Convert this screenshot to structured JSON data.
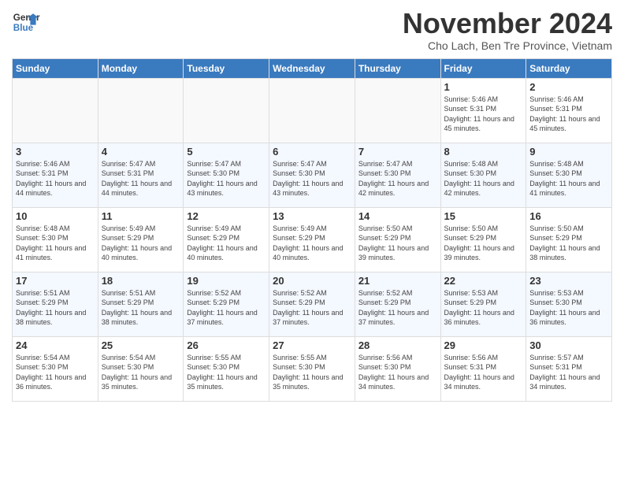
{
  "header": {
    "logo_line1": "General",
    "logo_line2": "Blue",
    "month": "November 2024",
    "location": "Cho Lach, Ben Tre Province, Vietnam"
  },
  "days_of_week": [
    "Sunday",
    "Monday",
    "Tuesday",
    "Wednesday",
    "Thursday",
    "Friday",
    "Saturday"
  ],
  "weeks": [
    [
      {
        "day": "",
        "empty": true
      },
      {
        "day": "",
        "empty": true
      },
      {
        "day": "",
        "empty": true
      },
      {
        "day": "",
        "empty": true
      },
      {
        "day": "",
        "empty": true
      },
      {
        "day": "1",
        "sunrise": "5:46 AM",
        "sunset": "5:31 PM",
        "daylight": "11 hours and 45 minutes."
      },
      {
        "day": "2",
        "sunrise": "5:46 AM",
        "sunset": "5:31 PM",
        "daylight": "11 hours and 45 minutes."
      }
    ],
    [
      {
        "day": "3",
        "sunrise": "5:46 AM",
        "sunset": "5:31 PM",
        "daylight": "11 hours and 44 minutes."
      },
      {
        "day": "4",
        "sunrise": "5:47 AM",
        "sunset": "5:31 PM",
        "daylight": "11 hours and 44 minutes."
      },
      {
        "day": "5",
        "sunrise": "5:47 AM",
        "sunset": "5:30 PM",
        "daylight": "11 hours and 43 minutes."
      },
      {
        "day": "6",
        "sunrise": "5:47 AM",
        "sunset": "5:30 PM",
        "daylight": "11 hours and 43 minutes."
      },
      {
        "day": "7",
        "sunrise": "5:47 AM",
        "sunset": "5:30 PM",
        "daylight": "11 hours and 42 minutes."
      },
      {
        "day": "8",
        "sunrise": "5:48 AM",
        "sunset": "5:30 PM",
        "daylight": "11 hours and 42 minutes."
      },
      {
        "day": "9",
        "sunrise": "5:48 AM",
        "sunset": "5:30 PM",
        "daylight": "11 hours and 41 minutes."
      }
    ],
    [
      {
        "day": "10",
        "sunrise": "5:48 AM",
        "sunset": "5:30 PM",
        "daylight": "11 hours and 41 minutes."
      },
      {
        "day": "11",
        "sunrise": "5:49 AM",
        "sunset": "5:29 PM",
        "daylight": "11 hours and 40 minutes."
      },
      {
        "day": "12",
        "sunrise": "5:49 AM",
        "sunset": "5:29 PM",
        "daylight": "11 hours and 40 minutes."
      },
      {
        "day": "13",
        "sunrise": "5:49 AM",
        "sunset": "5:29 PM",
        "daylight": "11 hours and 40 minutes."
      },
      {
        "day": "14",
        "sunrise": "5:50 AM",
        "sunset": "5:29 PM",
        "daylight": "11 hours and 39 minutes."
      },
      {
        "day": "15",
        "sunrise": "5:50 AM",
        "sunset": "5:29 PM",
        "daylight": "11 hours and 39 minutes."
      },
      {
        "day": "16",
        "sunrise": "5:50 AM",
        "sunset": "5:29 PM",
        "daylight": "11 hours and 38 minutes."
      }
    ],
    [
      {
        "day": "17",
        "sunrise": "5:51 AM",
        "sunset": "5:29 PM",
        "daylight": "11 hours and 38 minutes."
      },
      {
        "day": "18",
        "sunrise": "5:51 AM",
        "sunset": "5:29 PM",
        "daylight": "11 hours and 38 minutes."
      },
      {
        "day": "19",
        "sunrise": "5:52 AM",
        "sunset": "5:29 PM",
        "daylight": "11 hours and 37 minutes."
      },
      {
        "day": "20",
        "sunrise": "5:52 AM",
        "sunset": "5:29 PM",
        "daylight": "11 hours and 37 minutes."
      },
      {
        "day": "21",
        "sunrise": "5:52 AM",
        "sunset": "5:29 PM",
        "daylight": "11 hours and 37 minutes."
      },
      {
        "day": "22",
        "sunrise": "5:53 AM",
        "sunset": "5:29 PM",
        "daylight": "11 hours and 36 minutes."
      },
      {
        "day": "23",
        "sunrise": "5:53 AM",
        "sunset": "5:30 PM",
        "daylight": "11 hours and 36 minutes."
      }
    ],
    [
      {
        "day": "24",
        "sunrise": "5:54 AM",
        "sunset": "5:30 PM",
        "daylight": "11 hours and 36 minutes."
      },
      {
        "day": "25",
        "sunrise": "5:54 AM",
        "sunset": "5:30 PM",
        "daylight": "11 hours and 35 minutes."
      },
      {
        "day": "26",
        "sunrise": "5:55 AM",
        "sunset": "5:30 PM",
        "daylight": "11 hours and 35 minutes."
      },
      {
        "day": "27",
        "sunrise": "5:55 AM",
        "sunset": "5:30 PM",
        "daylight": "11 hours and 35 minutes."
      },
      {
        "day": "28",
        "sunrise": "5:56 AM",
        "sunset": "5:30 PM",
        "daylight": "11 hours and 34 minutes."
      },
      {
        "day": "29",
        "sunrise": "5:56 AM",
        "sunset": "5:31 PM",
        "daylight": "11 hours and 34 minutes."
      },
      {
        "day": "30",
        "sunrise": "5:57 AM",
        "sunset": "5:31 PM",
        "daylight": "11 hours and 34 minutes."
      }
    ]
  ]
}
